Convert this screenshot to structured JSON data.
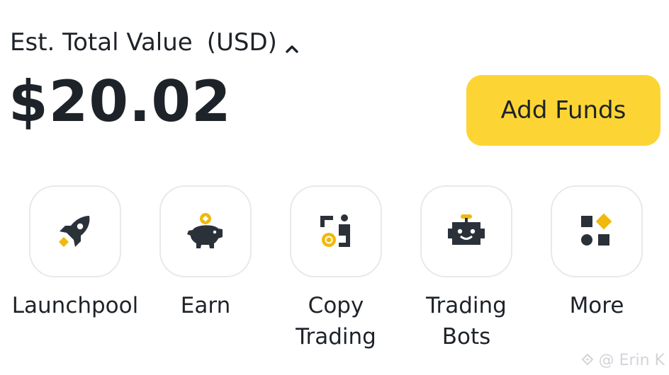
{
  "balance": {
    "label": "Est. Total Value",
    "currency": "(USD)",
    "value": "$20.02",
    "toggle_icon": "chevron-up-icon"
  },
  "add_funds": {
    "label": "Add Funds",
    "color": "#fcd535"
  },
  "shortcuts": [
    {
      "label": "Launchpool",
      "icon": "rocket-icon"
    },
    {
      "label": "Earn",
      "icon": "piggy-bank-icon"
    },
    {
      "label": "Copy\nTrading",
      "icon": "copy-trading-icon"
    },
    {
      "label": "Trading\nBots",
      "icon": "robot-icon"
    },
    {
      "label": "More",
      "icon": "more-grid-icon"
    }
  ],
  "watermark": {
    "text": "@ Erin K"
  },
  "colors": {
    "accent": "#fcd535",
    "icon_dark": "#2b3139",
    "icon_accent": "#f0b90b",
    "text": "#1e2329"
  }
}
